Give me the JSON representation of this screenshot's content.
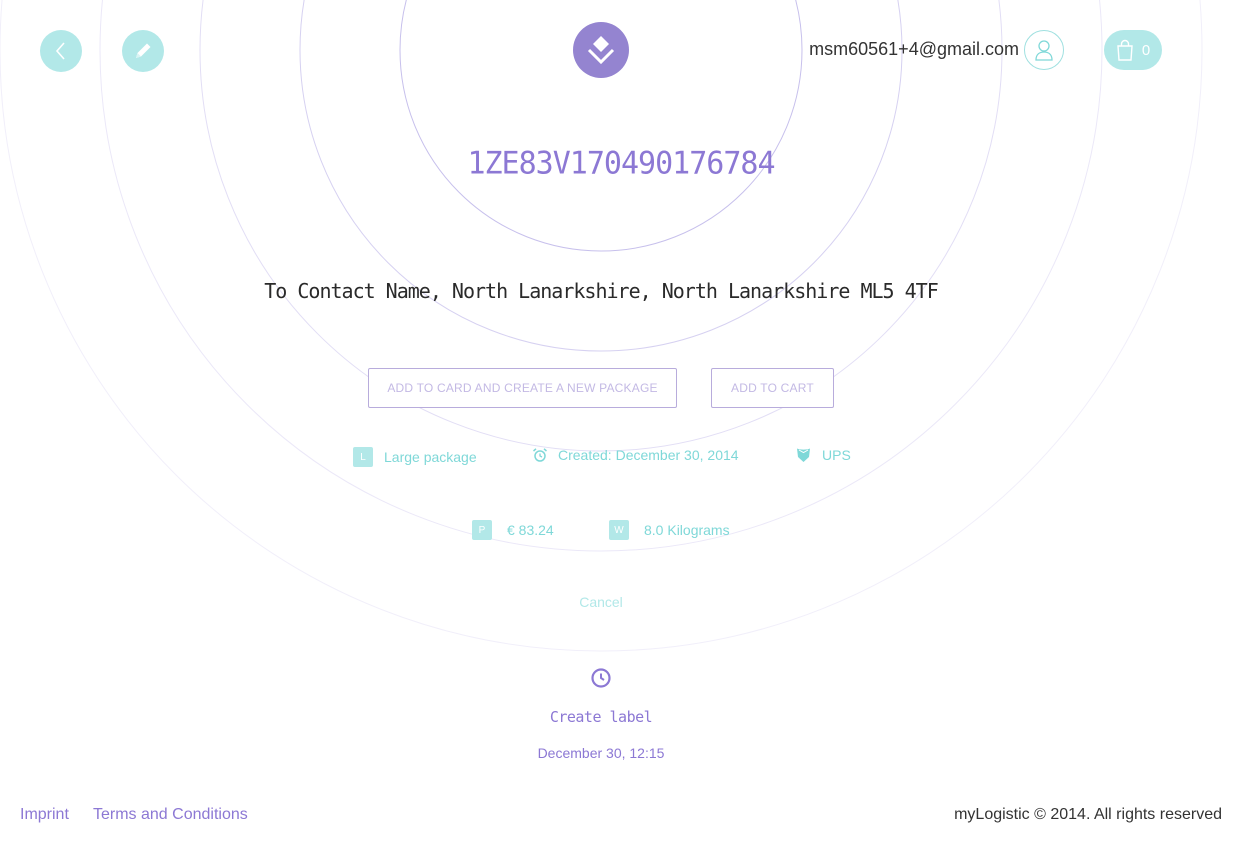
{
  "header": {
    "email": "msm60561+4@gmail.com",
    "cart_count": "0"
  },
  "package": {
    "tracking_number": "1ZE83V170490176784",
    "address": "To Contact Name, North Lanarkshire, North Lanarkshire ML5 4TF"
  },
  "actions": {
    "add_and_new_label": "ADD TO CARD AND CREATE A NEW PACKAGE",
    "add_to_cart_label": "ADD TO CART",
    "cancel_label": "Cancel"
  },
  "details": {
    "size_badge": "L",
    "size_label": "Large package",
    "created_label": "Created: December 30, 2014",
    "carrier_label": "UPS",
    "price_badge": "P",
    "price_label": "€ 83.24",
    "weight_badge": "W",
    "weight_label": "8.0 Kilograms"
  },
  "history": {
    "event_label": "Create label",
    "event_date": "December 30, 12:15"
  },
  "footer": {
    "imprint_label": "Imprint",
    "terms_label": "Terms and Conditions",
    "copyright": "myLogistic © 2014. All rights reserved"
  },
  "colors": {
    "accent_purple": "#8c78d4",
    "accent_teal": "#b2e8e8",
    "text_teal": "#7fd8d8"
  },
  "icons": [
    "back-arrow-icon",
    "pencil-icon",
    "logo-icon",
    "user-icon",
    "shopping-bag-icon",
    "alarm-clock-icon",
    "ups-shield-icon",
    "clock-icon"
  ]
}
